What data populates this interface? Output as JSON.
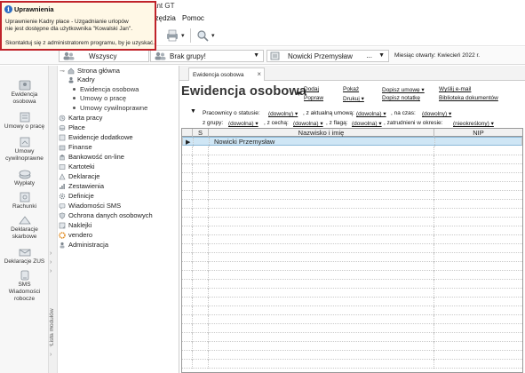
{
  "window": {
    "title_fragment": "ant GT"
  },
  "menu": {
    "items": [
      "rzędzia",
      "Pomoc"
    ]
  },
  "popup": {
    "title": "Uprawnienia",
    "line1": "Uprawnienie Kadry płace - Uzgadnianie urlopów",
    "line2": "nie jest dostępne dla użytkownika \"Kowalski Jan\".",
    "line3": "Skontaktuj się z administratorem programu, by je uzyskać."
  },
  "selectors": {
    "group_all": "Wszyscy",
    "group_none": "Brak grupy!",
    "company": "Nowicki Przemysław",
    "company_ellipsis": "...",
    "month_label": "Miesiąc otwarty: Kwiecień 2022 r."
  },
  "leftbar": {
    "items": [
      {
        "label1": "Ewidencja",
        "label2": "osobowa"
      },
      {
        "label1": "Umowy o pracę",
        "label2": ""
      },
      {
        "label1": "Umowy",
        "label2": "cywilnoprawne"
      },
      {
        "label1": "Wypłaty",
        "label2": ""
      },
      {
        "label1": "Rachunki",
        "label2": ""
      },
      {
        "label1": "Deklaracje",
        "label2": "skarbowe"
      },
      {
        "label1": "Deklaracje ZUS",
        "label2": ""
      },
      {
        "label1": "SMS",
        "label2": "Wiadomości",
        "label3": "robocze"
      }
    ],
    "module_list_label": "Lista modułów"
  },
  "tree": {
    "items": [
      "Strona główna",
      "Kadry",
      "Ewidencja osobowa",
      "Umowy o pracę",
      "Umowy cywilnoprawne",
      "Karta pracy",
      "Płace",
      "Ewidencje dodatkowe",
      "Finanse",
      "Bankowość on-line",
      "Kartoteki",
      "Deklaracje",
      "Zestawienia",
      "Definicje",
      "Wiadomości SMS",
      "Ochrona danych osobowych",
      "Naklejki",
      "vendero",
      "Administracja"
    ]
  },
  "main": {
    "tab_label": "Ewidencja osobowa",
    "page_title": "Ewidencja osobowa",
    "links": {
      "dodaj": "Dodaj",
      "popraw": "Popraw",
      "pokaz": "Pokaż",
      "drukuj": "Drukuj ▾",
      "dopisz_umowe": "Dopisz umowę ▾",
      "dopisz_notatke": "Dopisz notatkę",
      "wyslij_email": "Wyślij e-mail",
      "biblioteka": "Biblioteka dokumentów"
    },
    "filters": {
      "row1_prefix": "Pracownicy o statusie:",
      "status": "(dowolny) ▾",
      "aktualna": ", z aktualną umową:",
      "umowa": "(dowolna) ▾",
      "na_czas": ", na czas:",
      "czas": "(dowolny) ▾",
      "row2_prefix": "z grupy:",
      "grupa": "(dowolna) ▾",
      "cecha_lbl": ", z cechą:",
      "cecha": "(dowolna) ▾",
      "flaga_lbl": ", z flagą:",
      "flaga": "(dowolna) ▾",
      "okres_lbl": ", zatrudnieni w okresie:",
      "okres": "(nieokreślony) ▾"
    },
    "grid": {
      "columns": [
        "S",
        "Nazwisko i imię",
        "NIP"
      ],
      "rows": [
        {
          "name": "Nowicki Przemysław",
          "nip": ""
        }
      ]
    }
  }
}
